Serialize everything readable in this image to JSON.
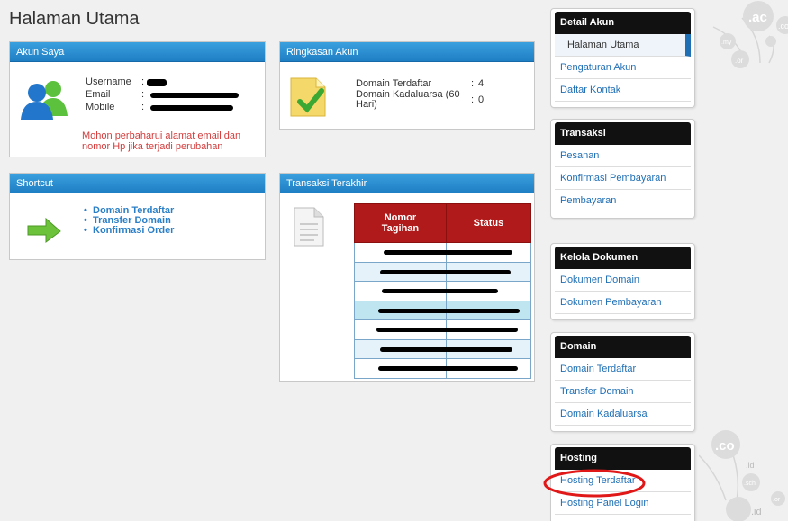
{
  "page": {
    "title": "Halaman Utama"
  },
  "akun_saya": {
    "heading": "Akun Saya",
    "fields": [
      {
        "label": "Username",
        "value_hidden": true
      },
      {
        "label": "Email",
        "value_hidden": true
      },
      {
        "label": "Mobile",
        "value_hidden": true
      }
    ],
    "colon": ":",
    "notice": "Mohon perbaharui alamat email dan nomor Hp jika terjadi perubahan"
  },
  "ringkasan_akun": {
    "heading": "Ringkasan Akun",
    "rows": [
      {
        "label": "Domain Terdaftar",
        "value": "4"
      },
      {
        "label": "Domain Kadaluarsa (60 Hari)",
        "value": "0"
      }
    ],
    "colon": ":"
  },
  "shortcut": {
    "heading": "Shortcut",
    "links": [
      "Domain Terdaftar",
      "Transfer Domain",
      "Konfirmasi Order"
    ]
  },
  "transaksi_terakhir": {
    "heading": "Transaksi Terakhir",
    "columns": [
      "Nomor Tagihan",
      "Status"
    ],
    "rows": 7,
    "values_hidden": true
  },
  "sidebar": {
    "sections": [
      {
        "heading": "Detail Akun",
        "items": [
          "Halaman Utama",
          "Pengaturan Akun",
          "Daftar Kontak"
        ],
        "active": "Halaman Utama"
      },
      {
        "heading": "Transaksi",
        "items": [
          "Pesanan",
          "Konfirmasi Pembayaran",
          "Pembayaran"
        ]
      },
      {
        "heading": "Kelola Dokumen",
        "items": [
          "Dokumen Domain",
          "Dokumen Pembayaran"
        ]
      },
      {
        "heading": "Domain",
        "items": [
          "Domain Terdaftar",
          "Transfer Domain",
          "Domain Kadaluarsa"
        ]
      },
      {
        "heading": "Hosting",
        "items": [
          "Hosting Terdaftar",
          "Hosting Panel Login"
        ],
        "highlighted": "Hosting Terdaftar"
      }
    ]
  },
  "decor": {
    "tld_bubbles_top": [
      ".ac",
      ".my",
      ".or",
      ".co"
    ],
    "tld_bubbles_bottom": [
      ".co",
      ".id",
      ".sch",
      ".or",
      ".id"
    ]
  },
  "colors": {
    "panel_header": "#2b8fd3",
    "table_header": "#b11a1a",
    "sidebar_header": "#111111",
    "link": "#1f6fb5",
    "notice": "#d43c3c",
    "annotation_circle": "#e01818"
  },
  "icons": {
    "akun_saya": "users-icon",
    "ringkasan_akun": "checked-document-icon",
    "shortcut": "green-arrow-icon",
    "transaksi_terakhir": "document-icon"
  }
}
